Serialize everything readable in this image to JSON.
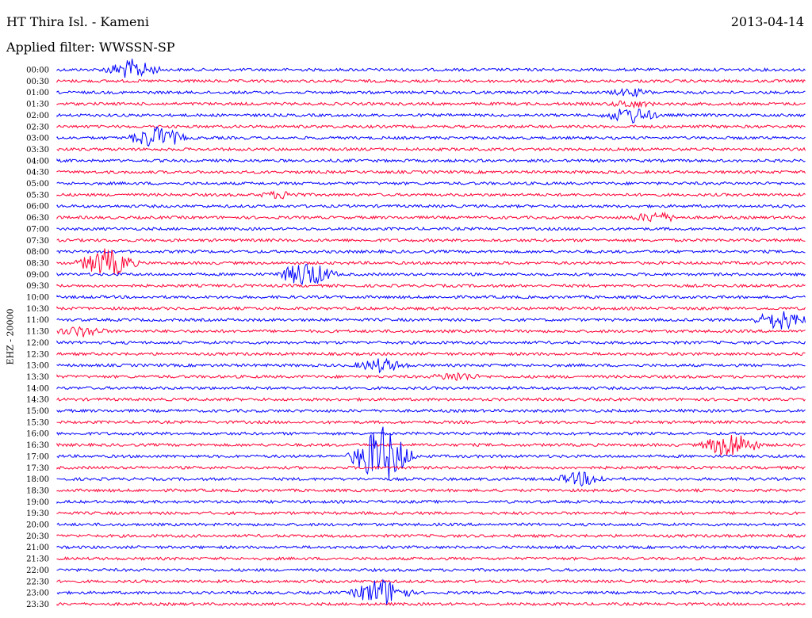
{
  "header": {
    "station": "HT Thira Isl. - Kameni",
    "date": "2013-04-14",
    "filter": "Applied filter: WWSSN-SP"
  },
  "axis": {
    "ylabel": "EHZ - 20000"
  },
  "colors": {
    "even": "#0000ff",
    "odd": "#ff0033"
  },
  "chart_data": {
    "type": "line",
    "title": "HT Thira Isl. - Kameni",
    "subtitle": "Applied filter: WWSSN-SP",
    "ylabel": "EHZ - 20000",
    "row_labels": [
      "00:00",
      "00:30",
      "01:00",
      "01:30",
      "02:00",
      "02:30",
      "03:00",
      "03:30",
      "04:00",
      "04:30",
      "05:00",
      "05:30",
      "06:00",
      "06:30",
      "07:00",
      "07:30",
      "08:00",
      "08:30",
      "09:00",
      "09:30",
      "10:00",
      "10:30",
      "11:00",
      "11:30",
      "12:00",
      "12:30",
      "13:00",
      "13:30",
      "14:00",
      "14:30",
      "15:00",
      "15:30",
      "16:00",
      "16:30",
      "17:00",
      "17:30",
      "18:00",
      "18:30",
      "19:00",
      "19:30",
      "20:00",
      "20:30",
      "21:00",
      "21:30",
      "22:00",
      "22:30",
      "23:00",
      "23:30"
    ],
    "traces_minutes_per_row": 30,
    "events": [
      {
        "row": "00:00",
        "minute": 3,
        "amplitude": 14
      },
      {
        "row": "01:00",
        "minute": 23,
        "amplitude": 6
      },
      {
        "row": "01:30",
        "minute": 23,
        "amplitude": 6
      },
      {
        "row": "02:00",
        "minute": 23,
        "amplitude": 12
      },
      {
        "row": "03:00",
        "minute": 4,
        "amplitude": 16
      },
      {
        "row": "05:30",
        "minute": 9,
        "amplitude": 6
      },
      {
        "row": "06:30",
        "minute": 24,
        "amplitude": 8
      },
      {
        "row": "08:30",
        "minute": 2,
        "amplitude": 20
      },
      {
        "row": "09:00",
        "minute": 10,
        "amplitude": 18
      },
      {
        "row": "11:00",
        "minute": 29,
        "amplitude": 14
      },
      {
        "row": "11:30",
        "minute": 1,
        "amplitude": 8
      },
      {
        "row": "13:00",
        "minute": 13,
        "amplitude": 10
      },
      {
        "row": "13:30",
        "minute": 16,
        "amplitude": 7
      },
      {
        "row": "16:30",
        "minute": 27,
        "amplitude": 18
      },
      {
        "row": "18:00",
        "minute": 21,
        "amplitude": 10
      },
      {
        "row": "17:00",
        "minute": 13,
        "amplitude": 40
      },
      {
        "row": "23:00",
        "minute": 13,
        "amplitude": 20
      }
    ],
    "grid": false
  }
}
